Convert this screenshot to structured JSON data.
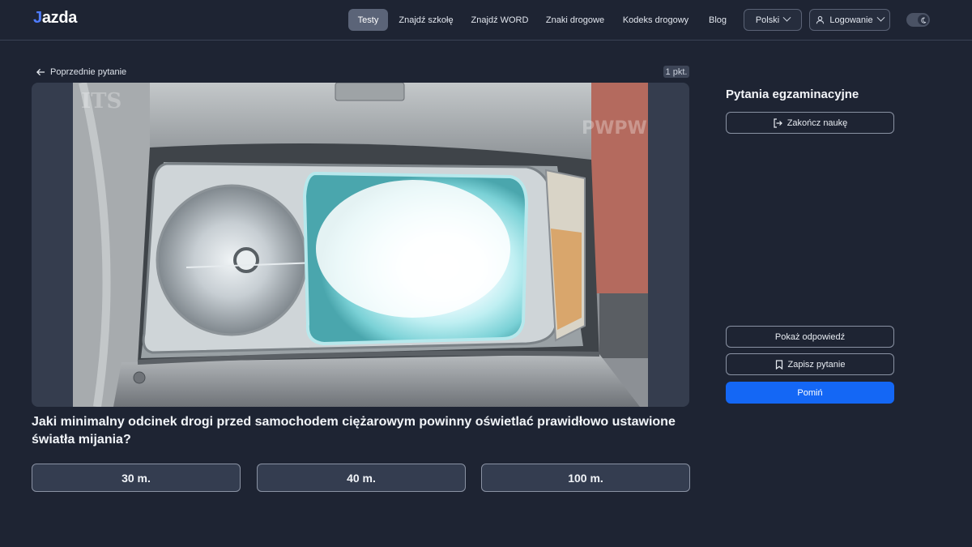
{
  "header": {
    "logo": {
      "first": "J",
      "rest": "azda"
    },
    "nav": [
      "Testy",
      "Znajdź szkołę",
      "Znajdź WORD",
      "Znaki drogowe",
      "Kodeks drogowy",
      "Blog"
    ],
    "language": "Polski",
    "login": "Logowanie",
    "theme_toggle_icon": "moon-icon"
  },
  "question_panel": {
    "back_label": "Poprzednie pytanie",
    "points": "1 pkt.",
    "media_icon": "truck-headlight-photo",
    "photo_watermarks": {
      "left": "ITS",
      "right": "PWPW"
    },
    "question_text": "Jaki minimalny odcinek drogi przed samochodem ciężarowym powinny oświetlać prawidłowo ustawione światła mijania?",
    "answers": [
      "30 m.",
      "40 m.",
      "100 m."
    ]
  },
  "sidebar": {
    "title": "Pytania egzaminacyjne",
    "end_learning": "Zakończ naukę",
    "show_answer": "Pokaż odpowiedź",
    "save_question": "Zapisz pytanie",
    "skip": "Pomiń"
  },
  "colors": {
    "background": "#1e2433",
    "primary": "#1467f5",
    "accent": "#4f7cff"
  }
}
